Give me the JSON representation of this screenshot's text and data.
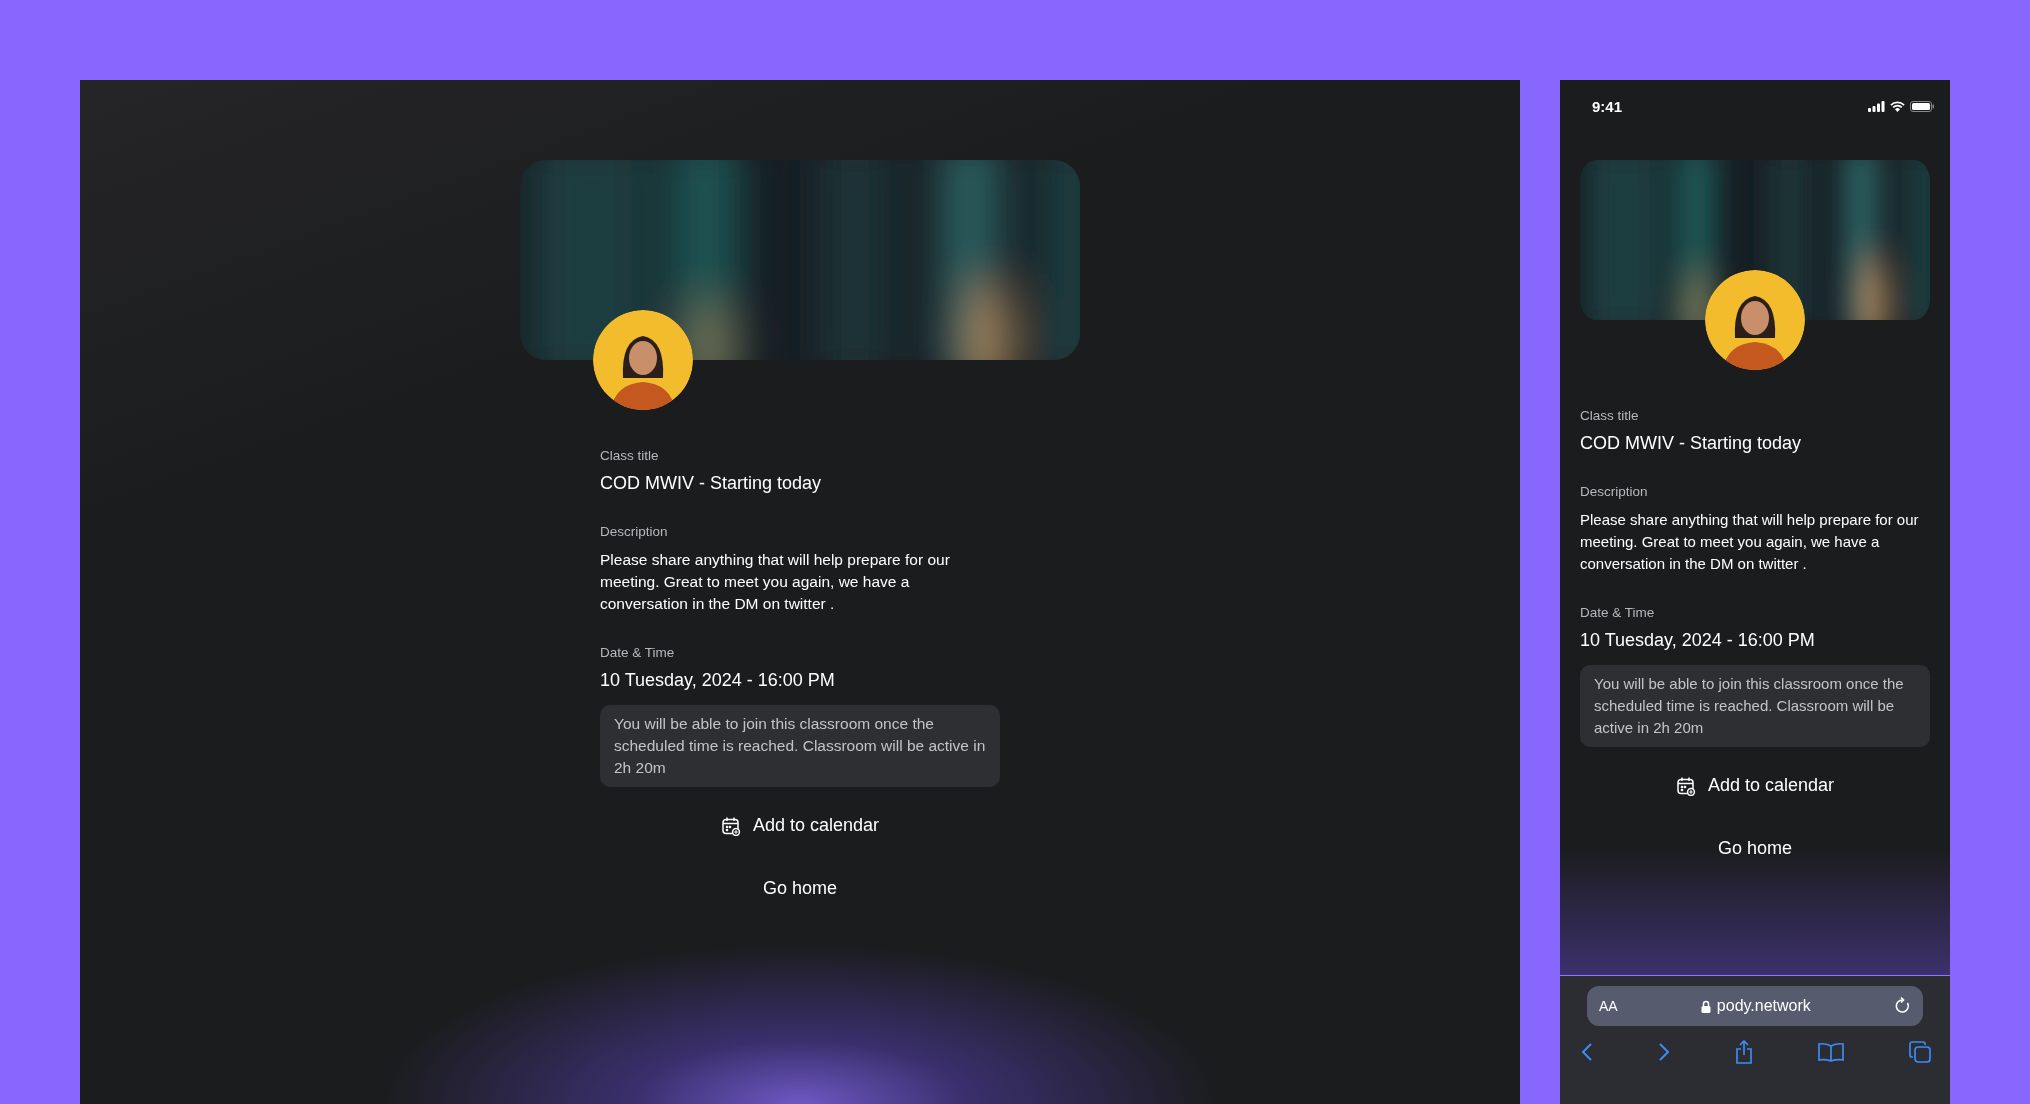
{
  "views": [
    {
      "kind": "desktop",
      "fields": [
        {
          "label": "Class title",
          "value": "COD MWIV - Starting today",
          "kind": "title"
        },
        {
          "label": "Description",
          "value": "Please share anything that will help prepare for our meeting. Great to meet you again, we have a conversation in the DM on twitter .",
          "kind": "text"
        },
        {
          "label": "Date & Time",
          "value": "10 Tuesday, 2024 - 16:00 PM",
          "kind": "title"
        }
      ],
      "notice": "You will be able to join this classroom once the scheduled time is reached. Classroom will be active in 2h 20m",
      "calendar_button": "Add to calendar",
      "home_button": "Go home"
    },
    {
      "kind": "mobile",
      "status_time": "9:41",
      "fields": [
        {
          "label": "Class title",
          "value": "COD MWIV - Starting today",
          "kind": "title"
        },
        {
          "label": "Description",
          "value": "Please share anything that will help prepare for our meeting. Great to meet you again, we have a conversation in the DM on twitter .",
          "kind": "text"
        },
        {
          "label": "Date & Time",
          "value": "10 Tuesday, 2024 - 16:00 PM",
          "kind": "title"
        }
      ],
      "notice": "You will be able to join this classroom once the scheduled time is reached. Classroom will be active in 2h 20m",
      "calendar_button": "Add to calendar",
      "home_button": "Go home",
      "browser": {
        "text_size_button": "AA",
        "url": "pody.network"
      }
    }
  ]
}
